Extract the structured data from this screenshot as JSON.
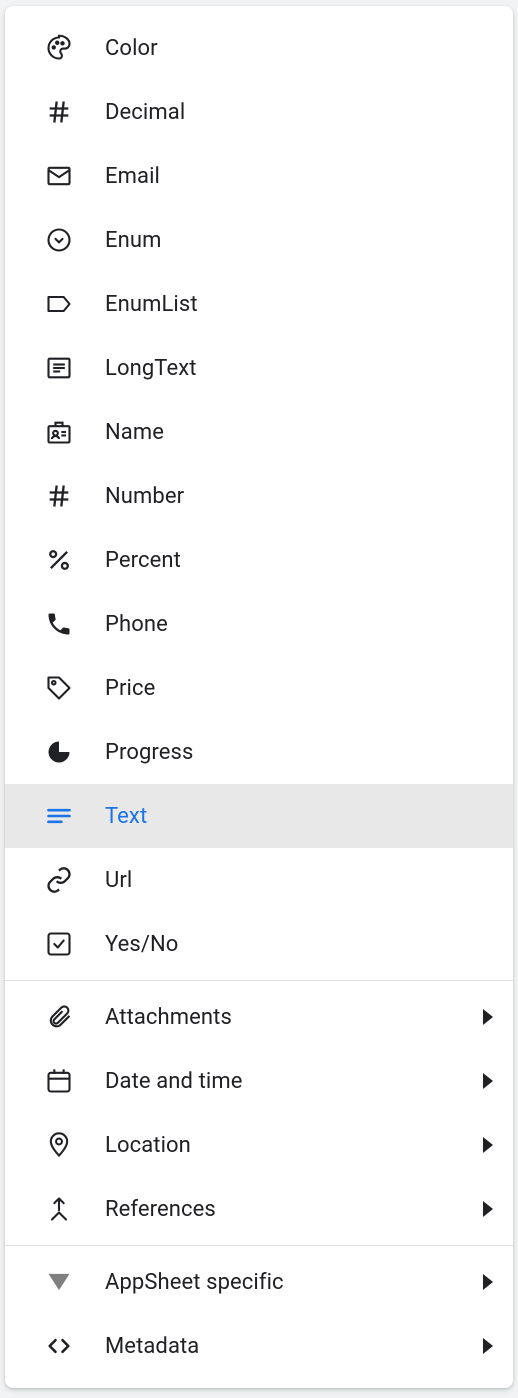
{
  "colors": {
    "selected_bg": "#e8e8e8",
    "selected_fg": "#1a73e8",
    "text": "#202124",
    "divider": "#e0e0e0"
  },
  "items": [
    {
      "icon": "palette-icon",
      "label": "Color"
    },
    {
      "icon": "hash-icon",
      "label": "Decimal"
    },
    {
      "icon": "email-icon",
      "label": "Email"
    },
    {
      "icon": "enum-icon",
      "label": "Enum"
    },
    {
      "icon": "tag-icon",
      "label": "EnumList"
    },
    {
      "icon": "longtext-icon",
      "label": "LongText"
    },
    {
      "icon": "name-badge-icon",
      "label": "Name"
    },
    {
      "icon": "hash-icon",
      "label": "Number"
    },
    {
      "icon": "percent-icon",
      "label": "Percent"
    },
    {
      "icon": "phone-icon",
      "label": "Phone"
    },
    {
      "icon": "price-tag-icon",
      "label": "Price"
    },
    {
      "icon": "progress-icon",
      "label": "Progress"
    },
    {
      "icon": "text-lines-icon",
      "label": "Text",
      "selected": true
    },
    {
      "icon": "link-icon",
      "label": "Url"
    },
    {
      "icon": "checkbox-icon",
      "label": "Yes/No"
    }
  ],
  "groups1": [
    {
      "icon": "attachment-icon",
      "label": "Attachments"
    },
    {
      "icon": "calendar-icon",
      "label": "Date and time"
    },
    {
      "icon": "location-icon",
      "label": "Location"
    },
    {
      "icon": "references-icon",
      "label": "References"
    }
  ],
  "groups2": [
    {
      "icon": "appsheet-icon",
      "label": "AppSheet specific"
    },
    {
      "icon": "code-icon",
      "label": "Metadata"
    }
  ]
}
